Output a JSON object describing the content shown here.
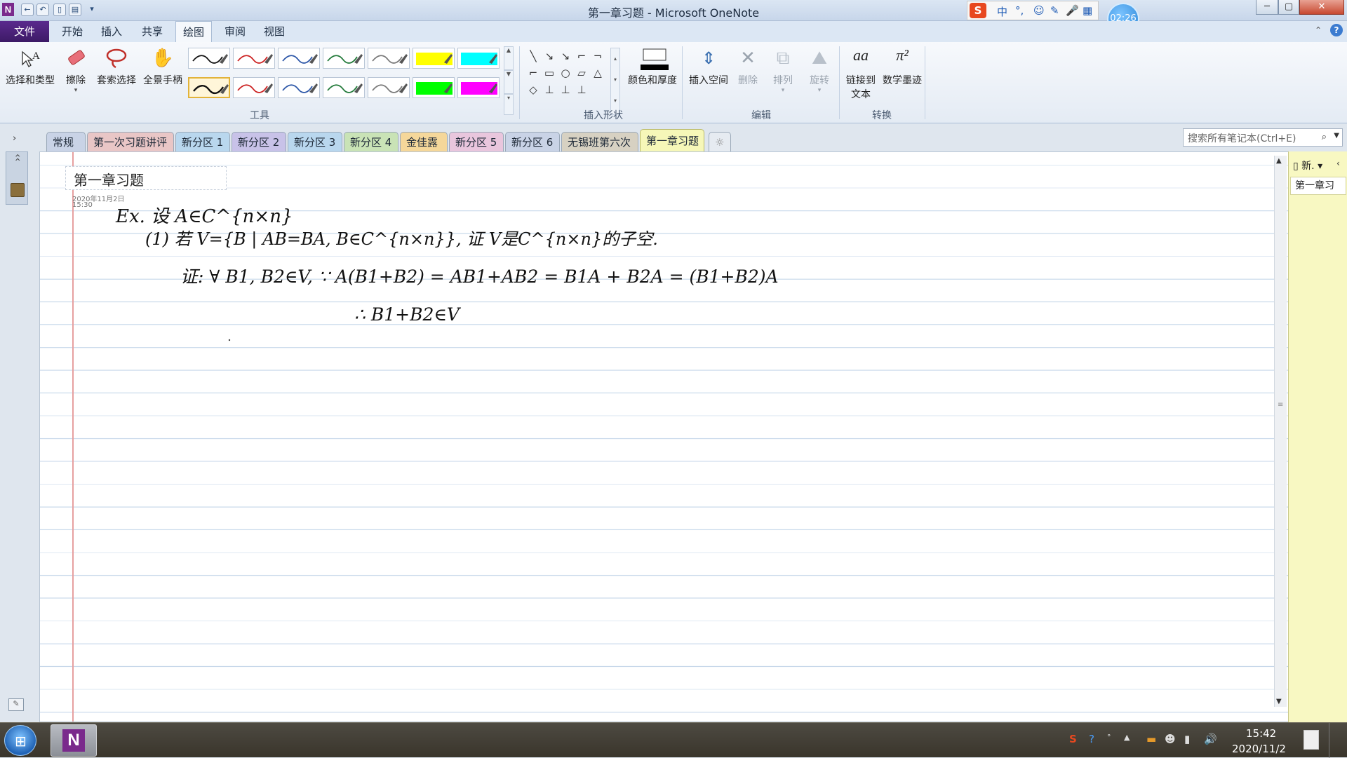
{
  "window": {
    "title": "第一章习题 - Microsoft OneNote",
    "app_icon_letter": "N",
    "controls": [
      "─",
      "▢",
      "✕"
    ]
  },
  "qat": [
    "←",
    "↶",
    "▯",
    "▤",
    "▾"
  ],
  "ime": {
    "logo": "S",
    "items": [
      "中",
      "°,",
      "☺",
      "✎",
      "🎤",
      "▦"
    ]
  },
  "clock_bubble": "02:26",
  "ribbon_tabs": {
    "file": "文件",
    "tabs": [
      "开始",
      "插入",
      "共享",
      "绘图",
      "审阅",
      "视图"
    ],
    "active": "绘图"
  },
  "ribbon": {
    "tools": {
      "label": "工具",
      "select_type": "选择和类型",
      "eraser": "擦除",
      "lasso": "套索选择",
      "panning_hand": "全景手柄"
    },
    "insert_shapes": {
      "label": "插入形状",
      "color_thickness": "颜色和厚度",
      "shapes": [
        "╲",
        "↘",
        "↘",
        "⌐",
        "¬",
        "⌐",
        "▭",
        "○",
        "▱",
        "△",
        "◇",
        "⊥",
        "⊥",
        "⊥"
      ]
    },
    "edit": {
      "label": "编辑",
      "insert_space": "插入空间",
      "delete": "删除",
      "arrange": "排列",
      "rotate": "旋转"
    },
    "convert": {
      "label": "转换",
      "ink_to_text_line1": "链接到",
      "ink_to_text_line2": "文本",
      "ink_to_math": "数学墨迹"
    },
    "pens": [
      "#111111",
      "#cc2222",
      "#2d57a8",
      "#237a3a",
      "#7a7a7a",
      "#ffff00",
      "#00ffff",
      "#111111",
      "#cc2222",
      "#2d57a8",
      "#237a3a",
      "#7a7a7a",
      "#00ff00",
      "#ff00ff"
    ]
  },
  "sections": {
    "tabs": [
      {
        "label": "常规",
        "color": "#c9d3e6"
      },
      {
        "label": "第一次习题讲评",
        "color": "#e9c6c6"
      },
      {
        "label": "新分区 1",
        "color": "#b9d7ee"
      },
      {
        "label": "新分区 2",
        "color": "#c8c2e8"
      },
      {
        "label": "新分区 3",
        "color": "#b9d7ee"
      },
      {
        "label": "新分区 4",
        "color": "#c9e3b6"
      },
      {
        "label": "金佳露",
        "color": "#f5d79a"
      },
      {
        "label": "新分区 5",
        "color": "#e9c6dd"
      },
      {
        "label": "新分区 6",
        "color": "#c9d3e6"
      },
      {
        "label": "无锡班第六次",
        "color": "#d7d1c2"
      },
      {
        "label": "第一章习题",
        "color": "#f6f7b8"
      }
    ],
    "add_tab": "☼",
    "search_placeholder": "搜索所有笔记本(Ctrl+E)"
  },
  "page": {
    "title": "第一章习题",
    "date": "2020年11月2日",
    "time": "15:30",
    "ink_text": [
      "Ex. 设 A∈C^{n×n}",
      "(1) 若 V={B | AB=BA, B∈C^{n×n}}, 证 V是C^{n×n}的子空.",
      "证: ∀ B1, B2∈V, ∵ A(B1+B2) = AB1+AB2 = B1A + B2A = (B1+B2)A",
      "∴ B1+B2∈V"
    ]
  },
  "page_list": {
    "new_page": "新.",
    "items": [
      "第一章习"
    ]
  },
  "taskbar": {
    "time": "15:42",
    "date": "2020/11/2"
  }
}
